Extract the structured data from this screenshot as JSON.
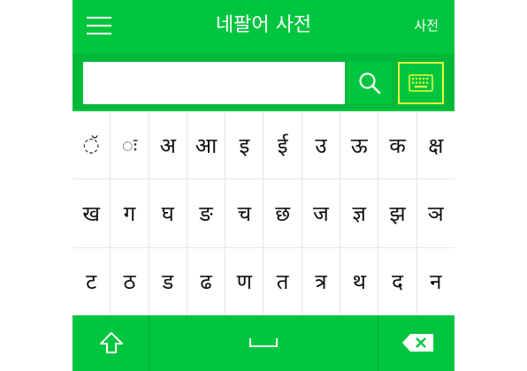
{
  "header": {
    "title": "네팔어 사전",
    "dict_link": "사전"
  },
  "search": {
    "value": "",
    "placeholder": ""
  },
  "icons": {
    "menu": "hamburger-menu-icon",
    "search": "search-icon",
    "keyboard": "keyboard-icon",
    "shift": "shift-arrow-icon",
    "space": "space-bar-icon",
    "backspace": "backspace-icon"
  },
  "keys": [
    [
      "◌̆",
      "◌ः",
      "अ",
      "आ",
      "इ",
      "ई",
      "उ",
      "ऊ",
      "क",
      "क्ष"
    ],
    [
      "ख",
      "ग",
      "घ",
      "ङ",
      "च",
      "छ",
      "ज",
      "ज्ञ",
      "झ",
      "ञ"
    ],
    [
      "ट",
      "ठ",
      "ड",
      "ढ",
      "ण",
      "त",
      "त्र",
      "थ",
      "द",
      "न"
    ]
  ],
  "colors": {
    "primary": "#00c63f",
    "search_row": "#00b93a",
    "keyboard_border": "#e6ff3a"
  }
}
